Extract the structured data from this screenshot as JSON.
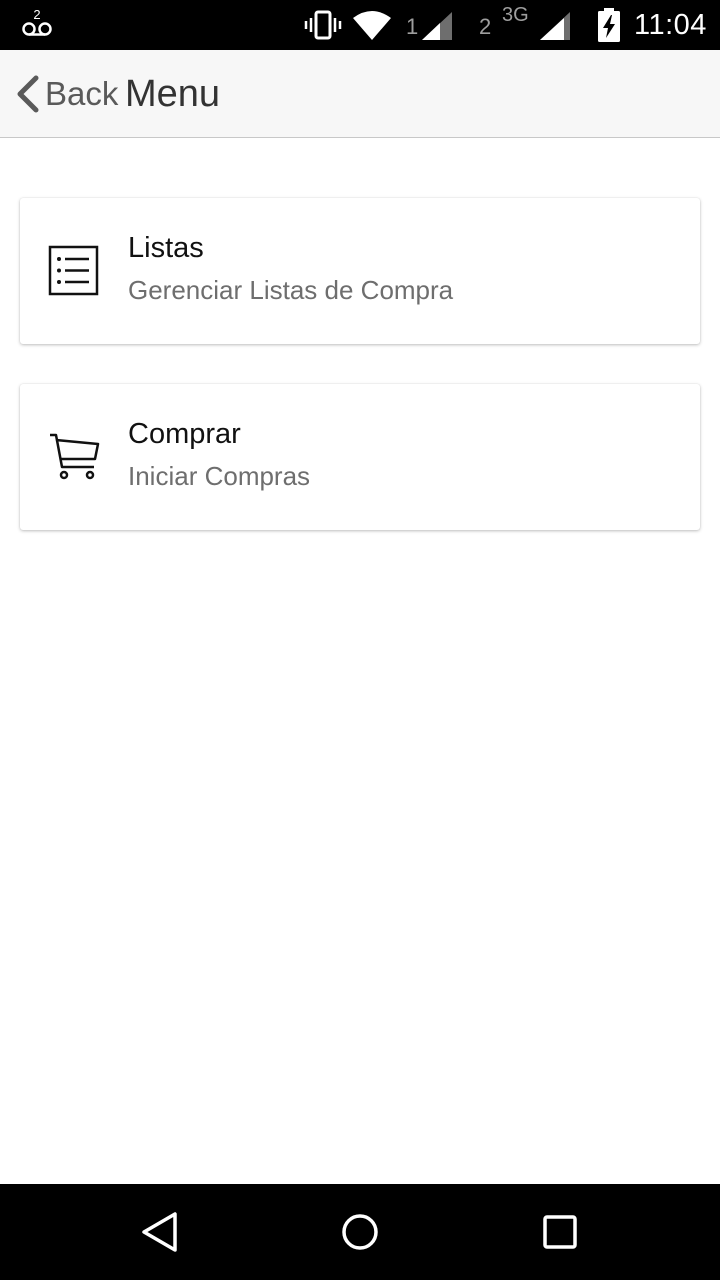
{
  "status_bar": {
    "voicemail_count": "2",
    "sim1_label": "1",
    "sim2_label": "2",
    "network_type": "3G",
    "time": "11:04",
    "icons": [
      "voicemail-icon",
      "vibrate-icon",
      "wifi-icon",
      "signal-icon",
      "signal-icon",
      "battery-charging-icon"
    ]
  },
  "header": {
    "back_label": "Back",
    "title": "Menu"
  },
  "menu": {
    "items": [
      {
        "title": "Listas",
        "subtitle": "Gerenciar Listas de Compra",
        "icon": "list-icon"
      },
      {
        "title": "Comprar",
        "subtitle": "Iniciar Compras",
        "icon": "shopping-cart-icon"
      }
    ]
  },
  "system_nav": {
    "icons": [
      "nav-back-icon",
      "nav-home-icon",
      "nav-recents-icon"
    ]
  },
  "colors": {
    "header_bg": "#f7f7f7",
    "title_text": "#333333",
    "subtitle_text": "#6e6e6e",
    "bars_bg": "#000000"
  }
}
